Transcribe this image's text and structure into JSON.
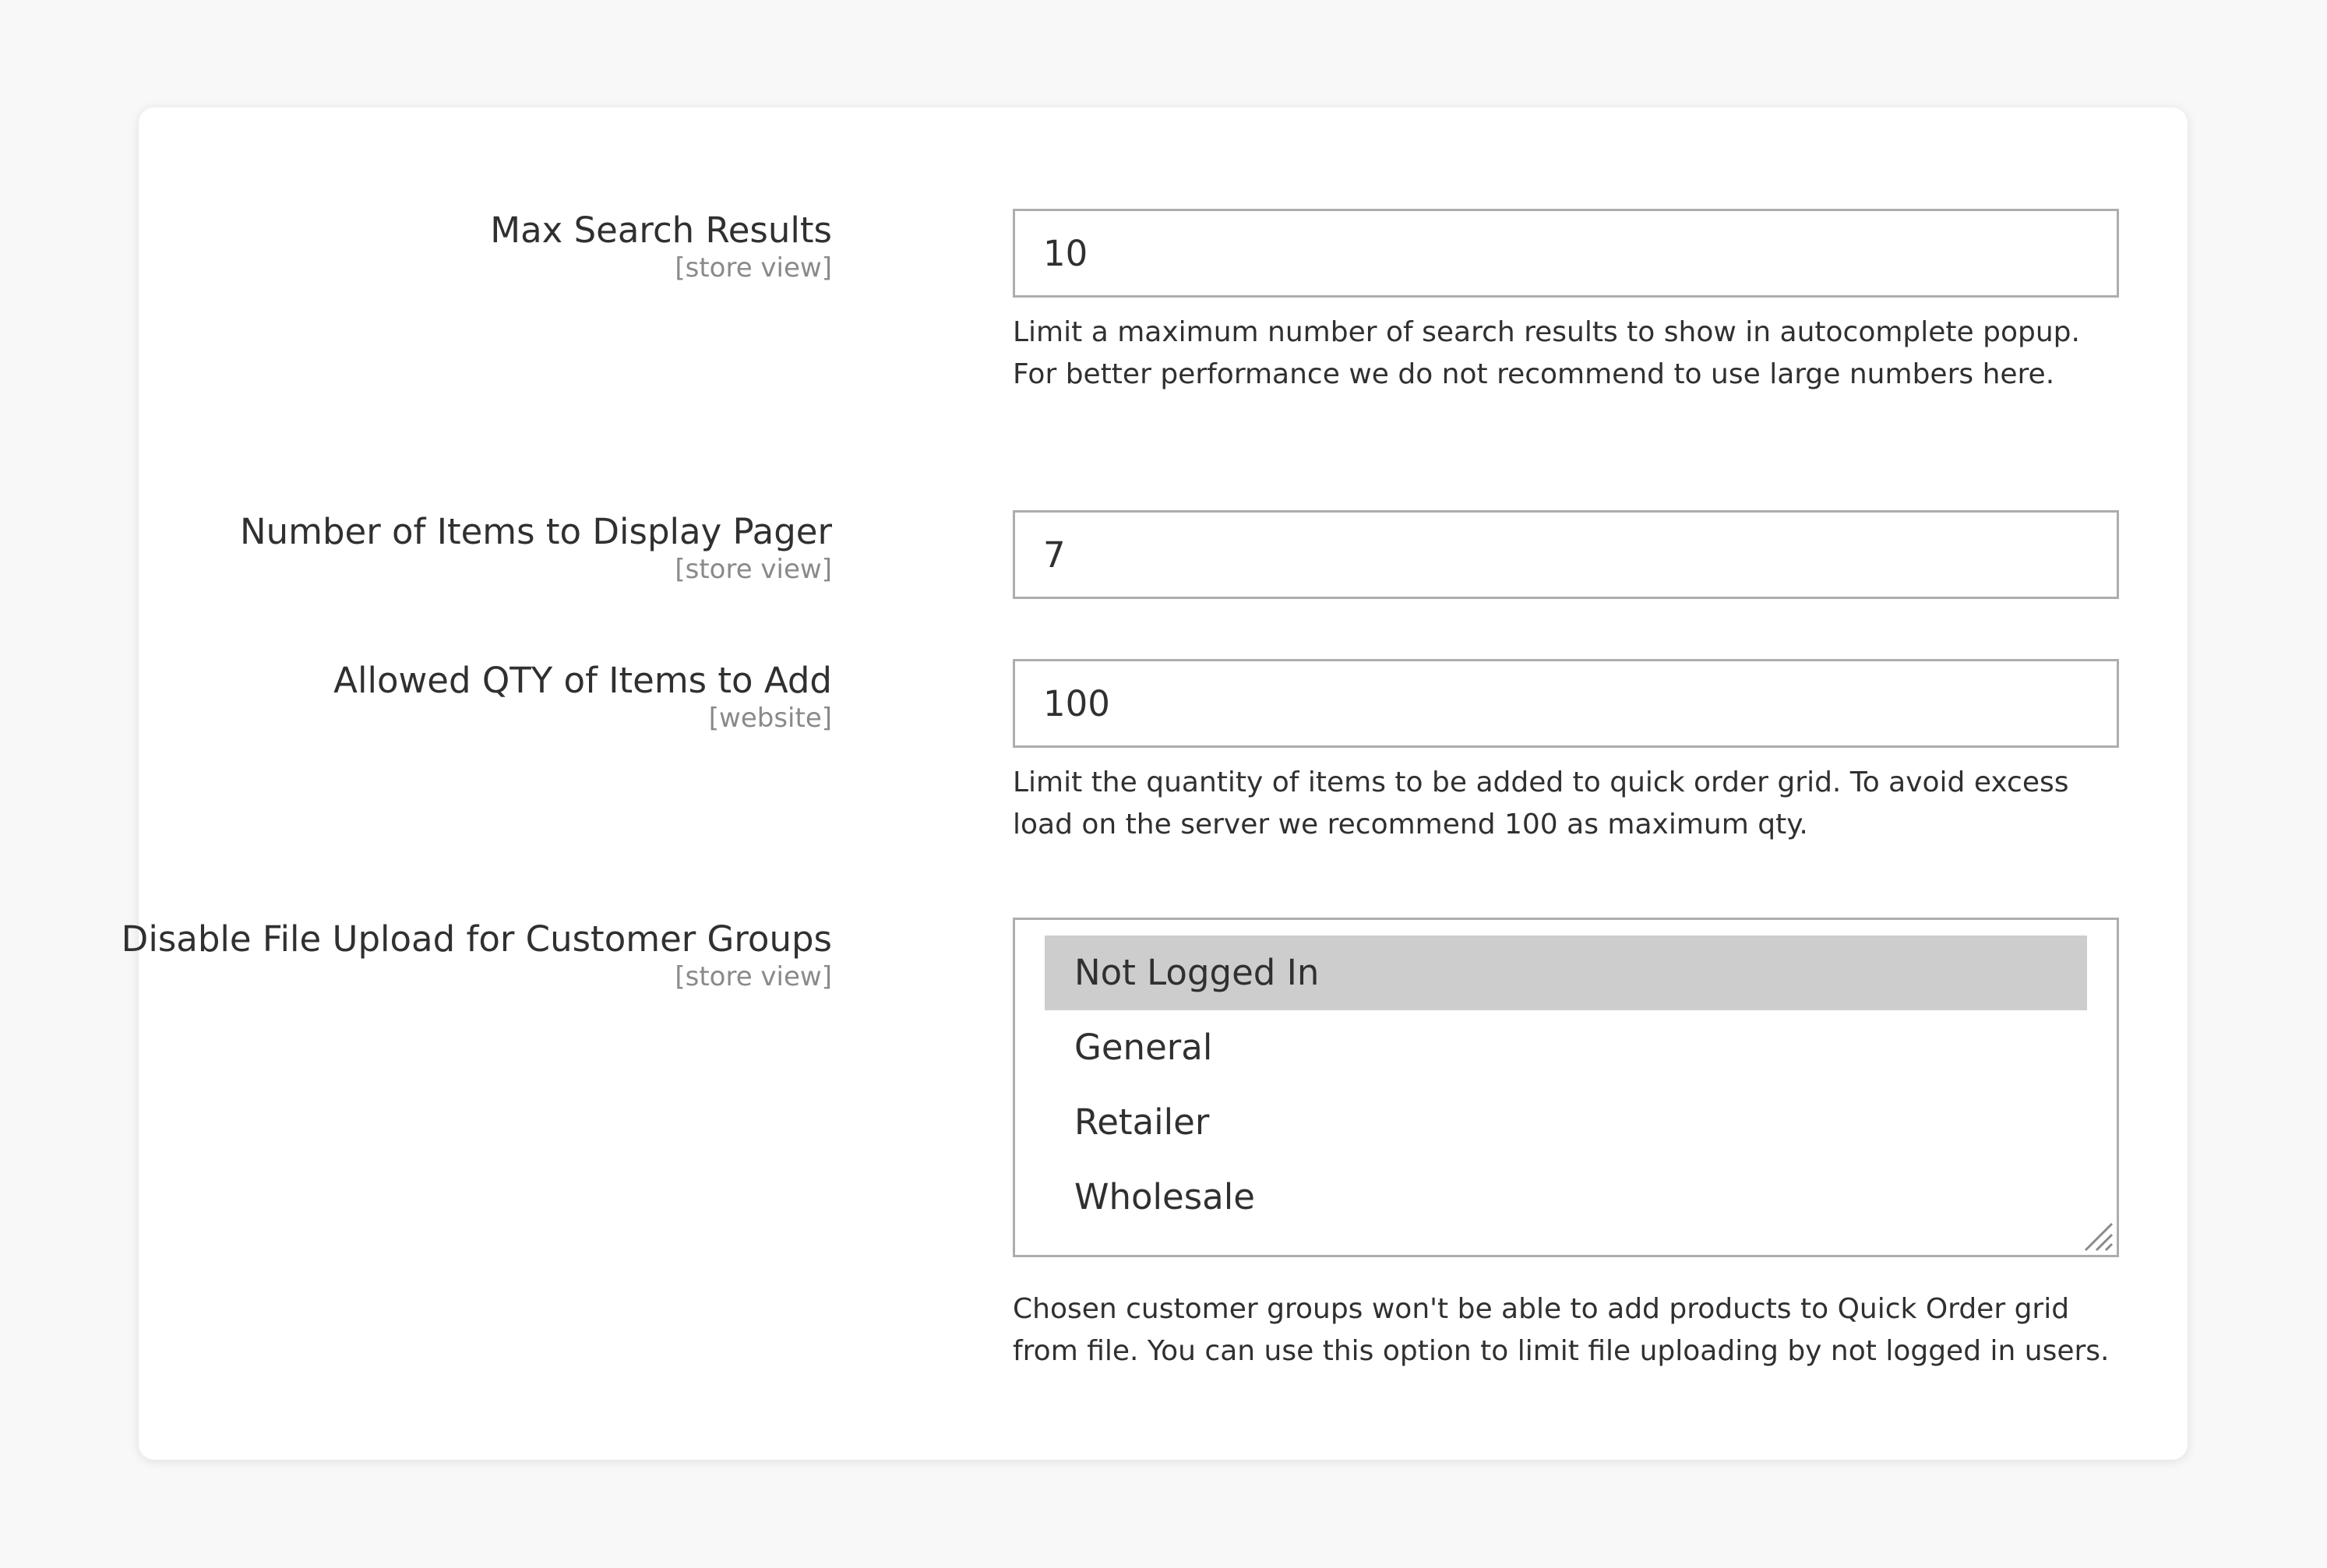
{
  "fields": {
    "max_search": {
      "label": "Max Search Results",
      "scope": "[store view]",
      "value": "10",
      "note": "Limit a maximum number of search results to show in autocomplete popup. For better performance we do not recommend to use large numbers here."
    },
    "pager": {
      "label": "Number of Items to Display Pager",
      "scope": "[store view]",
      "value": "7"
    },
    "allowed_qty": {
      "label": "Allowed QTY of Items to Add",
      "scope": "[website]",
      "value": "100",
      "note": "Limit the quantity of items to be added to quick order grid. To avoid excess load on the server we recommend 100 as maximum qty."
    },
    "disable_upload": {
      "label": "Disable File Upload for Customer Groups",
      "scope": "[store view]",
      "options": [
        "Not Logged In",
        "General",
        "Retailer",
        "Wholesale"
      ],
      "selected": "Not Logged In",
      "note": "Chosen customer groups won't be able to add products to Quick Order grid from file. You can use this option to limit file uploading by not logged in users."
    }
  },
  "colors": {
    "text": "#303030",
    "scope": "#8a8a8a",
    "border": "#adadad",
    "selected_option": "#cdcdcd"
  },
  "icons": {
    "resize": "resize-handle-icon"
  }
}
